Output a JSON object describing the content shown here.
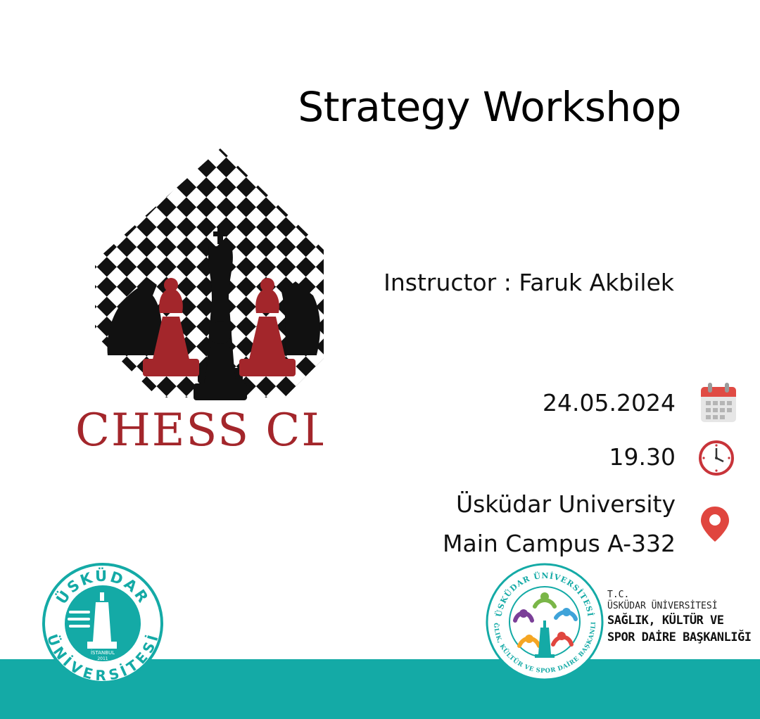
{
  "title": "Strategy Workshop",
  "logo": {
    "text": "CHESS CLU",
    "colors": {
      "red": "#a3262b",
      "black": "#111111"
    }
  },
  "instructor": {
    "label": "Instructor :",
    "name": "Faruk Akbilek"
  },
  "event": {
    "date": "24.05.2024",
    "time": "19.30",
    "location_line1": "Üsküdar University",
    "location_line2": "Main Campus A-332"
  },
  "icons": {
    "date": "calendar-icon",
    "time": "clock-icon",
    "location": "map-pin-icon"
  },
  "footer": {
    "band_color": "#14aaa6",
    "left_logo_text_top": "ÜSKÜDAR",
    "left_logo_text_bottom": "ÜNİVERSİTESİ",
    "left_logo_small": "İSTANBUL",
    "left_logo_year": "2011",
    "right_logo_ring_top": "ÜSKÜDAR ÜNİVERSİTESİ",
    "right_logo_ring_bottom": "SAĞLIK, KÜLTÜR VE SPOR DAİRE BAŞKANLIĞI",
    "dept_line1": "T.C.",
    "dept_line2": "ÜSKÜDAR ÜNİVERSİTESİ",
    "dept_line3": "SAĞLIK, KÜLTÜR VE",
    "dept_line4": "SPOR DAİRE BAŞKANLIĞI"
  }
}
